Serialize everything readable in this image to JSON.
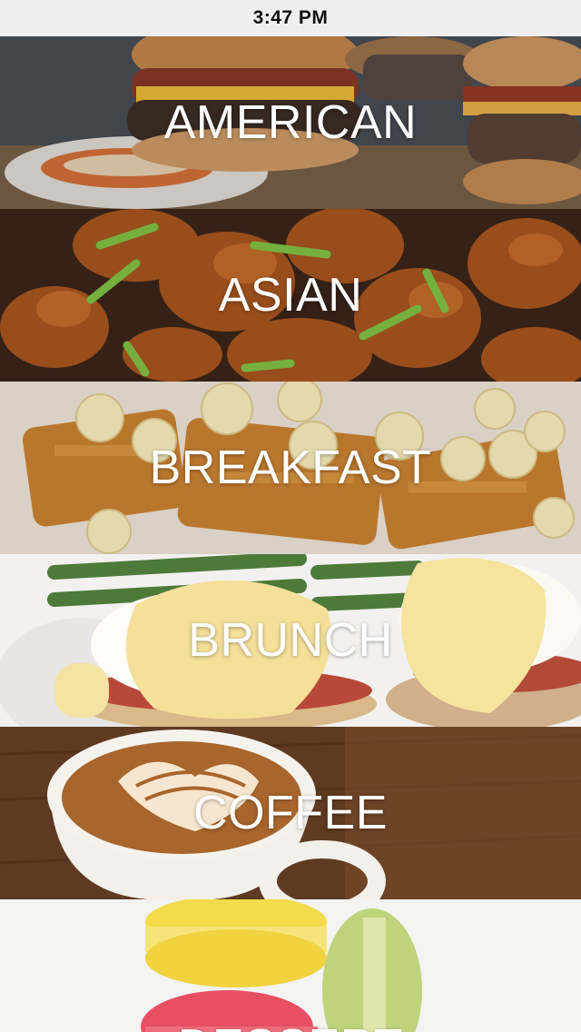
{
  "status_bar": {
    "time": "3:47 PM"
  },
  "categories": [
    {
      "id": "american",
      "label": "AMERICAN",
      "image_icon": "burger-photo"
    },
    {
      "id": "asian",
      "label": "ASIAN",
      "image_icon": "orange-chicken-photo"
    },
    {
      "id": "breakfast",
      "label": "BREAKFAST",
      "image_icon": "banana-waffles-photo"
    },
    {
      "id": "brunch",
      "label": "BRUNCH",
      "image_icon": "eggs-benedict-photo"
    },
    {
      "id": "coffee",
      "label": "COFFEE",
      "image_icon": "latte-art-photo"
    },
    {
      "id": "dessert",
      "label": "DESSERT",
      "image_icon": "macarons-photo"
    }
  ]
}
